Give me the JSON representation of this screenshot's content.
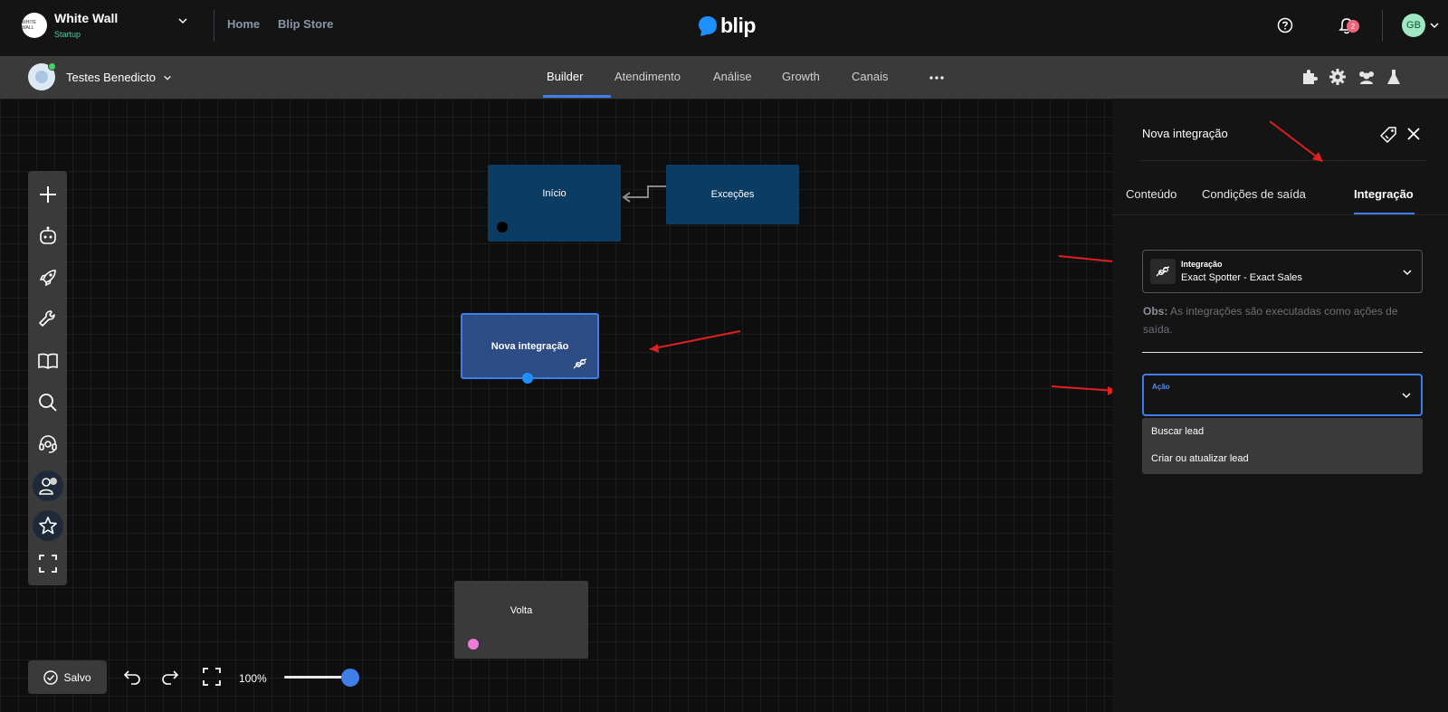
{
  "topbar": {
    "org_logo_text": "WHITE WALL",
    "org_name": "White Wall",
    "org_plan": "Startup",
    "links": [
      "Home",
      "Blip Store"
    ],
    "brand": "blip",
    "notification_count": "2",
    "user_initials": "GB"
  },
  "subbar": {
    "bot_name": "Testes Benedicto",
    "tabs": [
      "Builder",
      "Atendimento",
      "Análise",
      "Growth",
      "Canais"
    ],
    "active_tab": "Builder",
    "right_icons": [
      "puzzle-icon",
      "gear-icon",
      "users-icon",
      "flask-icon"
    ]
  },
  "canvas": {
    "nodes": {
      "inicio": "Início",
      "excecoes": "Exceções",
      "nova_integracao": "Nova integração",
      "volta": "Volta"
    },
    "toolbar": [
      "plus-icon",
      "bot-icon",
      "rocket-icon",
      "wrench-icon",
      "book-icon",
      "search-icon",
      "headset-icon",
      "user-chat-icon",
      "star-icon",
      "fullscreen-icon"
    ],
    "saved_label": "Salvo",
    "zoom_level": "100%",
    "zoom_fraction": 0.9
  },
  "panel": {
    "title": "Nova integração",
    "tabs": [
      "Conteúdo",
      "Condições de saída",
      "Integração"
    ],
    "active_tab": "Integração",
    "integration_label": "Integração",
    "integration_value": "Exact Spotter - Exact Sales",
    "obs_prefix": "Obs:",
    "obs_text": " As integrações são executadas como ações de saída.",
    "acao_label": "Ação",
    "acao_value": "",
    "acao_options": [
      "Buscar lead",
      "Criar ou atualizar lead"
    ]
  },
  "colors": {
    "accent": "#3f7de8",
    "node_blue": "#0b3c63",
    "annotation_red": "#e02020"
  }
}
